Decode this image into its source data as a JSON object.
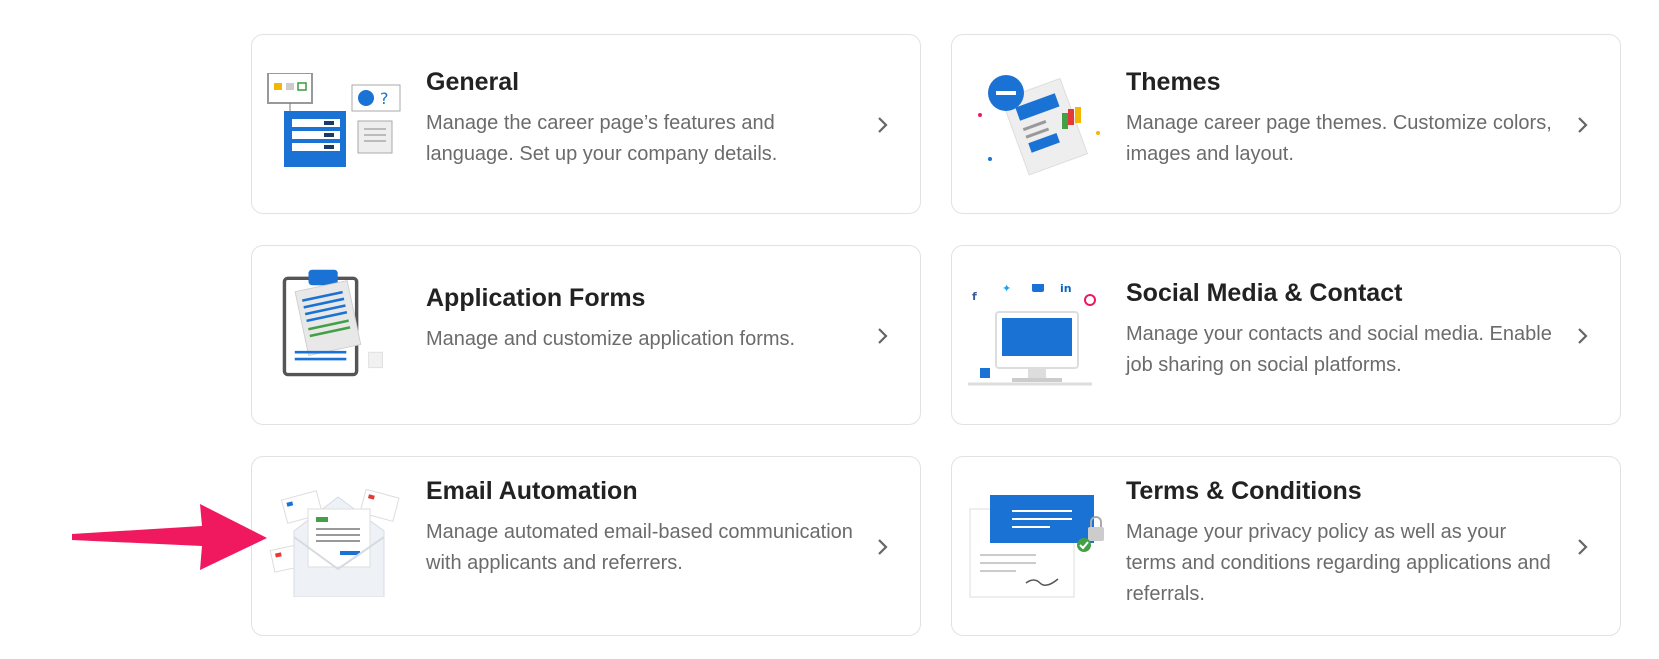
{
  "cards": [
    {
      "title": "General",
      "description": "Manage the career page’s features and language. Set up your company details."
    },
    {
      "title": "Themes",
      "description": "Manage career page themes. Customize colors, images and layout."
    },
    {
      "title": "Application Forms",
      "description": "Manage and customize application forms."
    },
    {
      "title": "Social Media & Contact",
      "description": "Manage your contacts and social media. Enable job sharing on social platforms."
    },
    {
      "title": "Email Automation",
      "description": "Manage automated email-based communication with applicants and referrers."
    },
    {
      "title": "Terms & Conditions",
      "description": "Manage your privacy policy as well as your terms and conditions regarding applications and referrals."
    }
  ],
  "colors": {
    "accent": "#1a73d4",
    "annotation_arrow": "#f0195f",
    "title": "#222222",
    "text": "#6b6b6b",
    "border": "#e2e2e2"
  },
  "icons": [
    "general-illustration",
    "themes-illustration",
    "application-forms-illustration",
    "social-media-illustration",
    "email-automation-illustration",
    "terms-illustration",
    "chevron-right-icon"
  ]
}
